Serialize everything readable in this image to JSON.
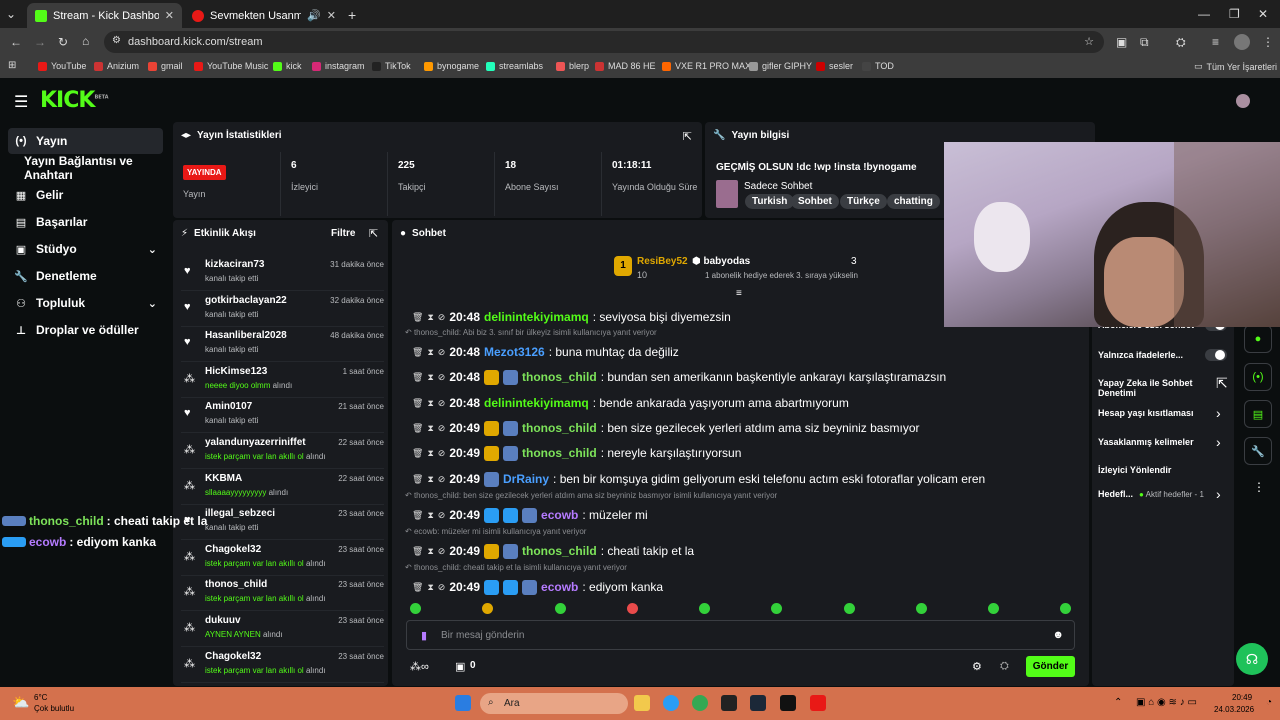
{
  "browser": {
    "tabs": [
      {
        "label": "Stream - Kick Dashboard"
      },
      {
        "label": "Sevmekten Usanmam | You"
      }
    ],
    "url": "dashboard.kick.com/stream",
    "bookmarks": [
      "YouTube",
      "Anizium",
      "gmail",
      "YouTube Music",
      "kick",
      "instagram",
      "TikTok",
      "bynogame",
      "streamlabs",
      "blerp",
      "MAD 86 HE",
      "VXE R1 PRO MAX",
      "gifler GIPHY",
      "sesler",
      "TOD"
    ],
    "all_bookmarks": "Tüm Yer İşaretleri"
  },
  "logo": {
    "text": "KICK",
    "sup": "BETA"
  },
  "nav": [
    {
      "icon": "(•)",
      "label": "Yayın"
    },
    {
      "icon": "",
      "label": "Yayın Bağlantısı ve Anahtarı"
    },
    {
      "icon": "▦",
      "label": "Gelir"
    },
    {
      "icon": "▤",
      "label": "Başarılar"
    },
    {
      "icon": "▣",
      "label": "Stüdyo"
    },
    {
      "icon": "🔧",
      "label": "Denetleme"
    },
    {
      "icon": "⚇",
      "label": "Topluluk"
    },
    {
      "icon": "⊥",
      "label": "Droplar ve ödüller"
    }
  ],
  "stats": {
    "title": "Yayın İstatistikleri",
    "live_badge": "YAYINDA",
    "live_label": "Yayın",
    "items": [
      {
        "value": "6",
        "label": "İzleyici"
      },
      {
        "value": "225",
        "label": "Takipçi"
      },
      {
        "value": "18",
        "label": "Abone Sayısı"
      },
      {
        "value": "01:18:11",
        "label": "Yayında Olduğu Süre"
      }
    ]
  },
  "info": {
    "title": "Yayın bilgisi",
    "stream_title": "GEÇMİŞ OLSUN !dc !wp !insta !bynogame",
    "category": "Sadece Sohbet",
    "tags": [
      "Turkish",
      "Sohbet",
      "Türkçe",
      "chatting"
    ]
  },
  "activity": {
    "title": "Etkinlik Akışı",
    "filter": "Filtre",
    "items": [
      {
        "icon": "♥",
        "name": "kizkaciran73",
        "time": "31 dakika önce",
        "desc": "kanalı takip etti",
        "highlight": ""
      },
      {
        "icon": "♥",
        "name": "gotkirbaclayan22",
        "time": "32 dakika önce",
        "desc": "kanalı takip etti",
        "highlight": ""
      },
      {
        "icon": "♥",
        "name": "Hasanliberal2028",
        "time": "48 dakika önce",
        "desc": "kanalı takip etti",
        "highlight": ""
      },
      {
        "icon": "⁂",
        "name": "HicKimse123",
        "time": "1 saat önce",
        "desc": "alındı",
        "highlight": "neeee diyoo olmm"
      },
      {
        "icon": "♥",
        "name": "Amin0107",
        "time": "21 saat önce",
        "desc": "kanalı takip etti",
        "highlight": ""
      },
      {
        "icon": "⁂",
        "name": "yalandunyazerriniffet",
        "time": "22 saat önce",
        "desc": "alındı",
        "highlight": "istek parçam var lan akıllı ol"
      },
      {
        "icon": "⁂",
        "name": "KKBMA",
        "time": "22 saat önce",
        "desc": "alındı",
        "highlight": "sllaaaayyyyyyyyy"
      },
      {
        "icon": "♥",
        "name": "illegal_sebzeci",
        "time": "23 saat önce",
        "desc": "kanalı takip etti",
        "highlight": ""
      },
      {
        "icon": "⁂",
        "name": "Chagokel32",
        "time": "23 saat önce",
        "desc": "alındı",
        "highlight": "istek parçam var lan akıllı ol"
      },
      {
        "icon": "⁂",
        "name": "thonos_child",
        "time": "23 saat önce",
        "desc": "alındı",
        "highlight": "istek parçam var lan akıllı ol"
      },
      {
        "icon": "⁂",
        "name": "dukuuv",
        "time": "23 saat önce",
        "desc": "alındı",
        "highlight": "AYNEN AYNEN"
      },
      {
        "icon": "⁂",
        "name": "Chagokel32",
        "time": "23 saat önce",
        "desc": "alındı",
        "highlight": "istek parçam var lan akıllı ol"
      }
    ]
  },
  "chat": {
    "title": "Sohbet",
    "leader_rank": "1",
    "leader_name": "ResiBey52",
    "leader_count": "10",
    "gifter_name": "babyodas",
    "gifter_count": "3",
    "gifter_desc": "1 abonelik hediye ederek 3. sıraya yükselin",
    "input_placeholder": "Bir mesaj gönderin",
    "points": "0",
    "send": "Gönder",
    "messages": [
      {
        "kind": "msg",
        "time": "20:48",
        "user": "delinintekiyimamq",
        "color": "#53fc18",
        "text": ": seviyosa bişi diyemezsin",
        "badges": []
      },
      {
        "kind": "reply",
        "text": "thonos_child: Abi biz 3. sınıf bir ülkeyiz isimli kullanıcıya yanıt veriyor"
      },
      {
        "kind": "msg",
        "time": "20:48",
        "user": "Mezot3126",
        "color": "#4a9fff",
        "text": ": buna muhtaç da değiliz",
        "badges": []
      },
      {
        "kind": "msg",
        "time": "20:48",
        "user": "thonos_child",
        "color": "#7de35a",
        "text": ": bundan sen amerikanın başkentiyle ankarayı karşılaştıramazsın",
        "badges": [
          "#e0a800",
          "#5a7fbf"
        ]
      },
      {
        "kind": "msg",
        "time": "20:48",
        "user": "delinintekiyimamq",
        "color": "#53fc18",
        "text": ": bende ankarada yaşıyorum ama abartmıyorum",
        "badges": []
      },
      {
        "kind": "msg",
        "time": "20:49",
        "user": "thonos_child",
        "color": "#7de35a",
        "text": ": ben size gezilecek yerleri atdım ama siz beyniniz basmıyor",
        "badges": [
          "#e0a800",
          "#5a7fbf"
        ]
      },
      {
        "kind": "msg",
        "time": "20:49",
        "user": "thonos_child",
        "color": "#7de35a",
        "text": ": nereyle karşılaştırıyorsun",
        "badges": [
          "#e0a800",
          "#5a7fbf"
        ]
      },
      {
        "kind": "msg",
        "time": "20:49",
        "user": "DrRainy",
        "color": "#4a9fff",
        "text": ": ben bir komşuya gidim geliyorum eski telefonu actım eski fotoraflar yolicam eren",
        "badges": [
          "#5a7fbf"
        ]
      },
      {
        "kind": "reply",
        "text": "thonos_child: ben size gezilecek yerleri atdım ama siz beyniniz basmıyor isimli kullanıcıya yanıt veriyor"
      },
      {
        "kind": "msg",
        "time": "20:49",
        "user": "ecowb",
        "color": "#b57bff",
        "text": ": müzeler mi",
        "badges": [
          "#2a9df4",
          "#2a9df4",
          "#5a7fbf"
        ]
      },
      {
        "kind": "reply",
        "text": "ecowb: müzeler mi isimli kullanıcıya yanıt veriyor"
      },
      {
        "kind": "msg",
        "time": "20:49",
        "user": "thonos_child",
        "color": "#7de35a",
        "text": ": cheati takip et la",
        "badges": [
          "#e0a800",
          "#5a7fbf"
        ]
      },
      {
        "kind": "reply",
        "text": "thonos_child: cheati takip et la isimli kullanıcıya yanıt veriyor"
      },
      {
        "kind": "msg",
        "time": "20:49",
        "user": "ecowb",
        "color": "#b57bff",
        "text": ": ediyom kanka",
        "badges": [
          "#2a9df4",
          "#2a9df4",
          "#5a7fbf"
        ]
      }
    ]
  },
  "settings": [
    {
      "label": "Abonelere özel sohbet",
      "toggle": true
    },
    {
      "label": "Yalnızca ifadelerle...",
      "toggle": true
    },
    {
      "label": "Yapay Zeka ile Sohbet Denetimi",
      "toggle": false,
      "arrow": "⇱"
    },
    {
      "label": "Hesap yaşı kısıtlaması",
      "toggle": false,
      "arrow": "›"
    },
    {
      "label": "Yasaklanmış kelimeler",
      "toggle": false,
      "arrow": "›"
    },
    {
      "label": "İzleyici Yönlendir",
      "toggle": false,
      "arrow": ""
    },
    {
      "label": "Hedefl...",
      "toggle": false,
      "arrow": "›",
      "extra": "Aktif hedefler - 1"
    }
  ],
  "overlay": [
    {
      "user": "thonos_child",
      "text": ": cheati takip et la",
      "color": "#7de35a"
    },
    {
      "user": "ecowb",
      "text": ": ediyom kanka",
      "color": "#b57bff"
    }
  ],
  "taskbar": {
    "temp": "6°C",
    "weather": "Çok bulutlu",
    "search": "Ara",
    "time": "20:49",
    "date": "24.03.2026"
  }
}
